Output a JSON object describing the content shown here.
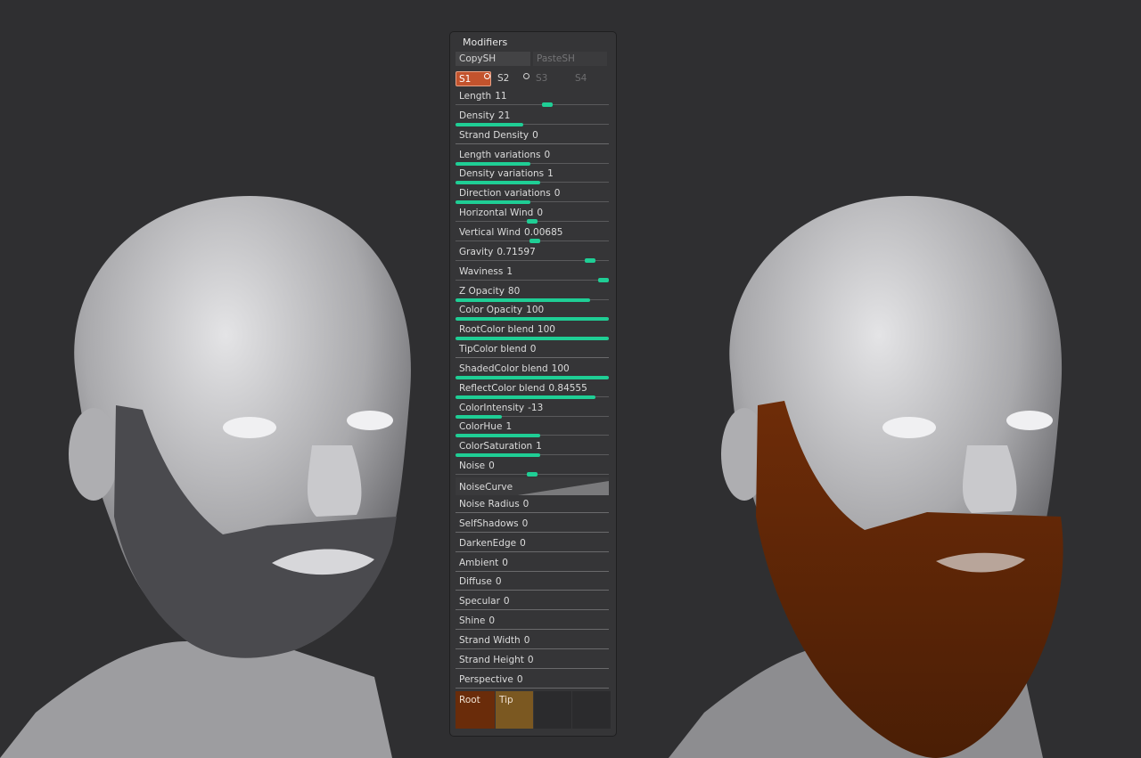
{
  "panel": {
    "title": "Modifiers",
    "copy_label": "CopySH",
    "paste_label": "PasteSH",
    "slots": [
      "S1",
      "S2",
      "S3",
      "S4"
    ],
    "active_slot": "S1",
    "sliders": [
      {
        "label": "Length",
        "value": "11",
        "fraction": 0.6,
        "style": "knob"
      },
      {
        "label": "Density",
        "value": "21",
        "fraction": 0.44,
        "style": "fill"
      },
      {
        "label": "Strand Density",
        "value": "0",
        "fraction": 0,
        "style": "none"
      },
      {
        "label": "Length variations",
        "value": "0",
        "fraction": 0.49,
        "style": "fill"
      },
      {
        "label": "Density variations",
        "value": "1",
        "fraction": 0.55,
        "style": "fill"
      },
      {
        "label": "Direction variations",
        "value": "0",
        "fraction": 0.49,
        "style": "fill"
      },
      {
        "label": "Horizontal Wind",
        "value": "0",
        "fraction": 0.5,
        "style": "knob"
      },
      {
        "label": "Vertical Wind",
        "value": "0.00685",
        "fraction": 0.52,
        "style": "knob"
      },
      {
        "label": "Gravity",
        "value": "0.71597",
        "fraction": 0.88,
        "style": "knob"
      },
      {
        "label": "Waviness",
        "value": "1",
        "fraction": 1.0,
        "style": "knob"
      },
      {
        "label": "Z Opacity",
        "value": "80",
        "fraction": 0.88,
        "style": "fill"
      },
      {
        "label": "Color Opacity",
        "value": "100",
        "fraction": 1.0,
        "style": "fill"
      },
      {
        "label": "RootColor blend",
        "value": "100",
        "fraction": 1.0,
        "style": "fill"
      },
      {
        "label": "TipColor blend",
        "value": "0",
        "fraction": 0,
        "style": "none"
      },
      {
        "label": "ShadedColor blend",
        "value": "100",
        "fraction": 1.0,
        "style": "fill"
      },
      {
        "label": "ReflectColor blend",
        "value": "0.84555",
        "fraction": 0.91,
        "style": "fill"
      },
      {
        "label": "ColorIntensity",
        "value": "-13",
        "fraction": 0.3,
        "style": "fill"
      },
      {
        "label": "ColorHue",
        "value": "1",
        "fraction": 0.55,
        "style": "fill"
      },
      {
        "label": "ColorSaturation",
        "value": "1",
        "fraction": 0.55,
        "style": "fill"
      },
      {
        "label": "Noise",
        "value": "0",
        "fraction": 0.5,
        "style": "knob"
      }
    ],
    "noise_curve_label": "NoiseCurve",
    "sliders_b": [
      {
        "label": "Noise Radius",
        "value": "0"
      },
      {
        "label": "SelfShadows",
        "value": "0"
      },
      {
        "label": "DarkenEdge",
        "value": "0"
      },
      {
        "label": "Ambient",
        "value": "0"
      },
      {
        "label": "Diffuse",
        "value": "0"
      },
      {
        "label": "Specular",
        "value": "0"
      },
      {
        "label": "Shine",
        "value": "0"
      },
      {
        "label": "Strand Width",
        "value": "0"
      },
      {
        "label": "Strand Height",
        "value": "0"
      },
      {
        "label": "Perspective",
        "value": "0"
      }
    ],
    "swatches": {
      "root_label": "Root",
      "tip_label": "Tip",
      "root_color": "#6a2c0a",
      "tip_color": "#7b5821"
    }
  },
  "colors": {
    "accent": "#1fce95",
    "active_slot": "#c2532d",
    "background": "#2f2f31"
  }
}
